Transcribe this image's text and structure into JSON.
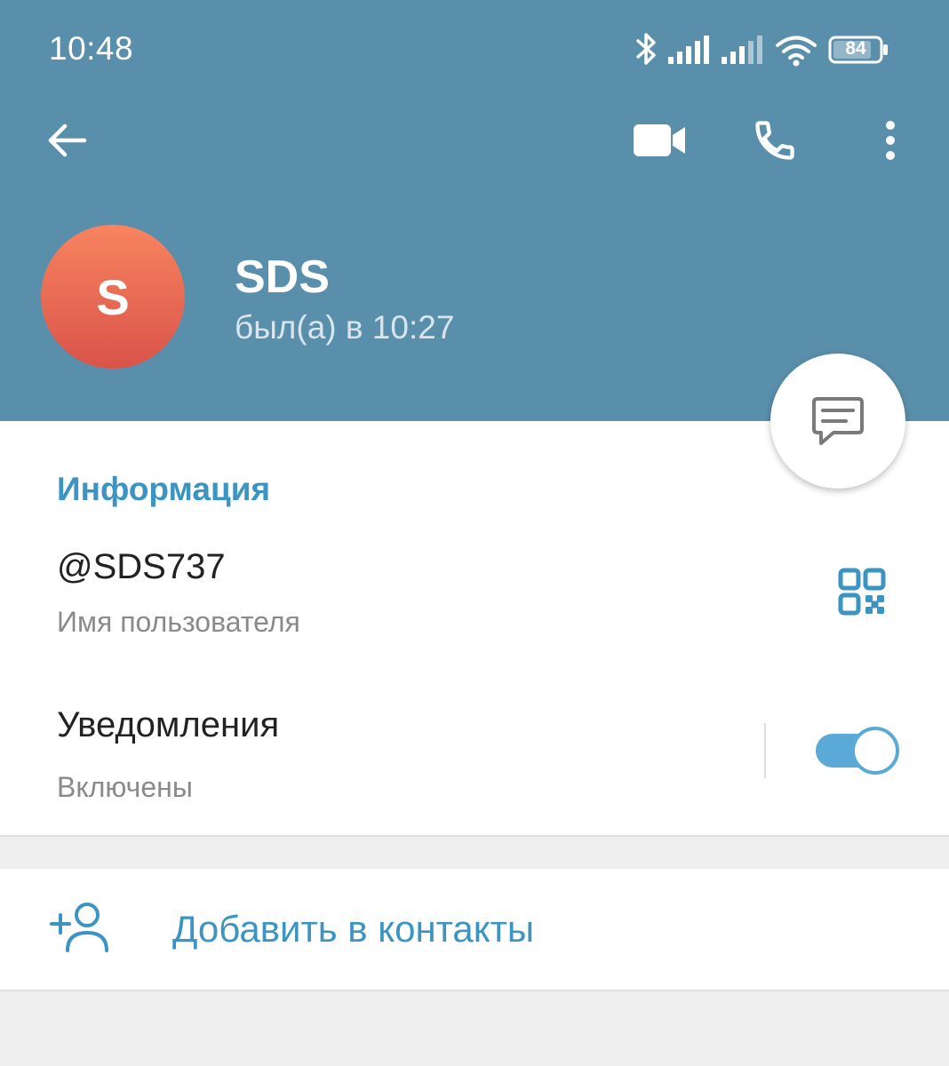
{
  "status_bar": {
    "time": "10:48",
    "battery_level": "84",
    "icons": [
      "bluetooth-icon",
      "signal-icon",
      "signal-icon",
      "wifi-icon",
      "battery-icon"
    ]
  },
  "toolbar": {
    "back_icon": "arrow-left-icon",
    "video_call_icon": "video-camera-icon",
    "call_icon": "phone-icon",
    "more_icon": "more-vertical-icon"
  },
  "profile": {
    "avatar_letter": "S",
    "name": "SDS",
    "last_seen": "был(а) в 10:27"
  },
  "fab": {
    "icon": "message-icon"
  },
  "info": {
    "section_title": "Информация",
    "username": "@SDS737",
    "username_caption": "Имя пользователя",
    "qr_icon": "qr-code-icon",
    "notifications_title": "Уведомления",
    "notifications_caption": "Включены",
    "notifications_on": true
  },
  "actions": {
    "add_contact_label": "Добавить в контакты",
    "add_contact_icon": "add-user-icon"
  },
  "colors": {
    "header_bg": "#5a8fab",
    "accent": "#3b94c1",
    "toggle": "#5aa9d6",
    "avatar_top": "#f8845f",
    "avatar_bottom": "#d9534a"
  }
}
